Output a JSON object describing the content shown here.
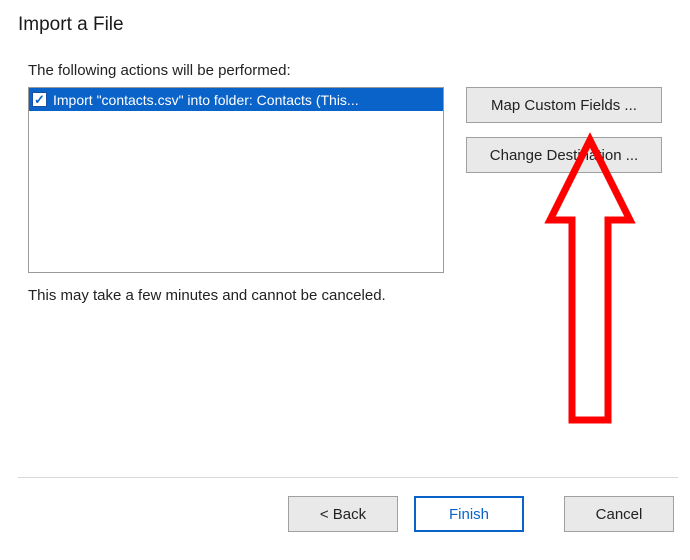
{
  "dialog": {
    "title": "Import a File",
    "actions_label": "The following actions will be performed:",
    "note": "This may take a few minutes and cannot be canceled.",
    "list_items": [
      {
        "checked": true,
        "selected": true,
        "text": "Import \"contacts.csv\" into folder: Contacts (This..."
      }
    ],
    "side_buttons": {
      "map_custom": "Map Custom Fields ...",
      "change_dest": "Change Destination ..."
    },
    "bottom_buttons": {
      "back": "< Back",
      "finish": "Finish",
      "cancel": "Cancel"
    }
  },
  "annotation": {
    "arrow_color": "#ff0000"
  }
}
